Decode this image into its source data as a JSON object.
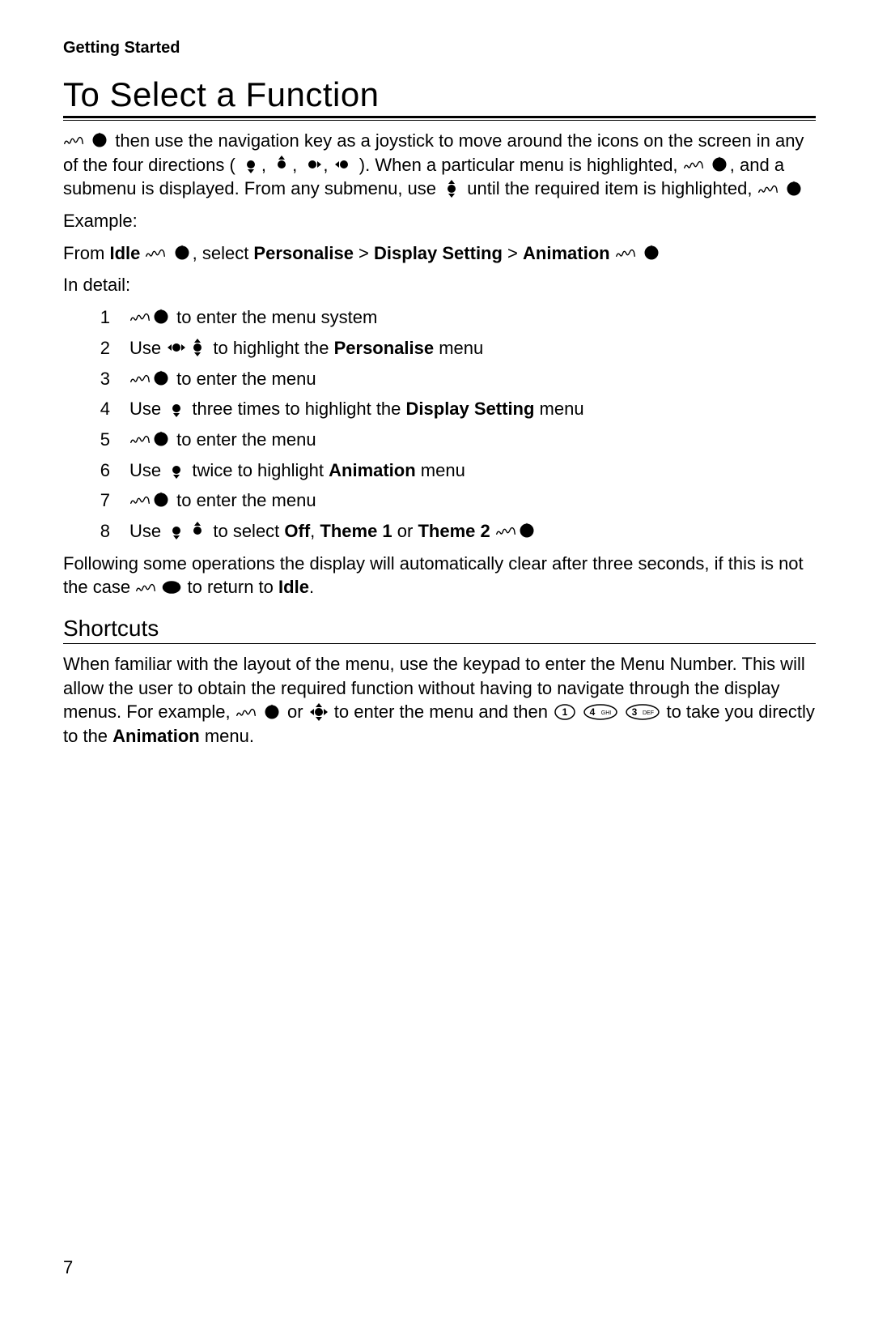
{
  "running_head": "Getting Started",
  "title": "To Select a Function",
  "intro": {
    "seg1": " then use the navigation key as a joystick to move around the icons on the screen in any of the four directions (",
    "seg2": ",",
    "seg3": ",",
    "seg4": ",",
    "seg5": "). When a particular menu is highlighted, ",
    "seg6": ", and a submenu is displayed. From any submenu, use ",
    "seg7": " until the required item is highlighted, "
  },
  "example_label": "Example:",
  "example": {
    "seg_from": "From ",
    "idle": "Idle",
    "seg_select": ", select ",
    "personalise": "Personalise",
    "gt1": " > ",
    "display_setting": "Display Setting",
    "gt2": " > ",
    "animation": "Animation"
  },
  "in_detail_label": "In detail:",
  "steps": [
    {
      "n": "1",
      "segs": [
        {
          "icon": "press"
        },
        {
          "icon": "select"
        },
        {
          "t": " to enter the menu system"
        }
      ]
    },
    {
      "n": "2",
      "segs": [
        {
          "t": "Use "
        },
        {
          "icon": "nav-leftright"
        },
        {
          "icon": "nav-updown"
        },
        {
          "t": " to highlight the "
        },
        {
          "b": "Personalise"
        },
        {
          "t": " menu"
        }
      ]
    },
    {
      "n": "3",
      "segs": [
        {
          "icon": "press"
        },
        {
          "icon": "select"
        },
        {
          "t": " to enter the menu"
        }
      ]
    },
    {
      "n": "4",
      "segs": [
        {
          "t": "Use "
        },
        {
          "icon": "nav-down"
        },
        {
          "t": " three times to highlight the "
        },
        {
          "b": "Display Setting"
        },
        {
          "t": " menu"
        }
      ]
    },
    {
      "n": "5",
      "segs": [
        {
          "icon": "press"
        },
        {
          "icon": "select"
        },
        {
          "t": " to enter the menu"
        }
      ]
    },
    {
      "n": "6",
      "segs": [
        {
          "t": "Use "
        },
        {
          "icon": "nav-down"
        },
        {
          "t": " twice to highlight "
        },
        {
          "b": "Animation"
        },
        {
          "t": " menu"
        }
      ]
    },
    {
      "n": "7",
      "segs": [
        {
          "icon": "press"
        },
        {
          "icon": "select"
        },
        {
          "t": " to enter the menu"
        }
      ]
    },
    {
      "n": "8",
      "segs": [
        {
          "t": "Use "
        },
        {
          "icon": "nav-down"
        },
        {
          "icon": "nav-up"
        },
        {
          "t": " to select "
        },
        {
          "b": "Off"
        },
        {
          "t": ", "
        },
        {
          "b": "Theme 1"
        },
        {
          "t": " or "
        },
        {
          "b": "Theme 2"
        },
        {
          "t": " "
        },
        {
          "icon": "press"
        },
        {
          "icon": "select"
        }
      ]
    }
  ],
  "after_steps": {
    "seg1": "Following some operations the display will automatically clear after three seconds, if this is not the case ",
    "seg2": " to return to ",
    "idle": "Idle",
    "seg3": "."
  },
  "shortcuts_heading": "Shortcuts",
  "shortcuts_para": {
    "seg1": "When familiar with the layout of the menu, use the keypad to enter the Menu Number. This will allow the user to obtain the required function without having to navigate through the display menus. For example, ",
    "seg_or": " or ",
    "seg_enter": " to enter the menu and then ",
    "seg_take": " to take you directly to the ",
    "animation": "Animation",
    "seg_end": " menu."
  },
  "keys": {
    "k1": "1",
    "k4": "4",
    "k4sub": "GHI",
    "k3": "3",
    "k3sub": "DEF"
  },
  "page_number": "7"
}
